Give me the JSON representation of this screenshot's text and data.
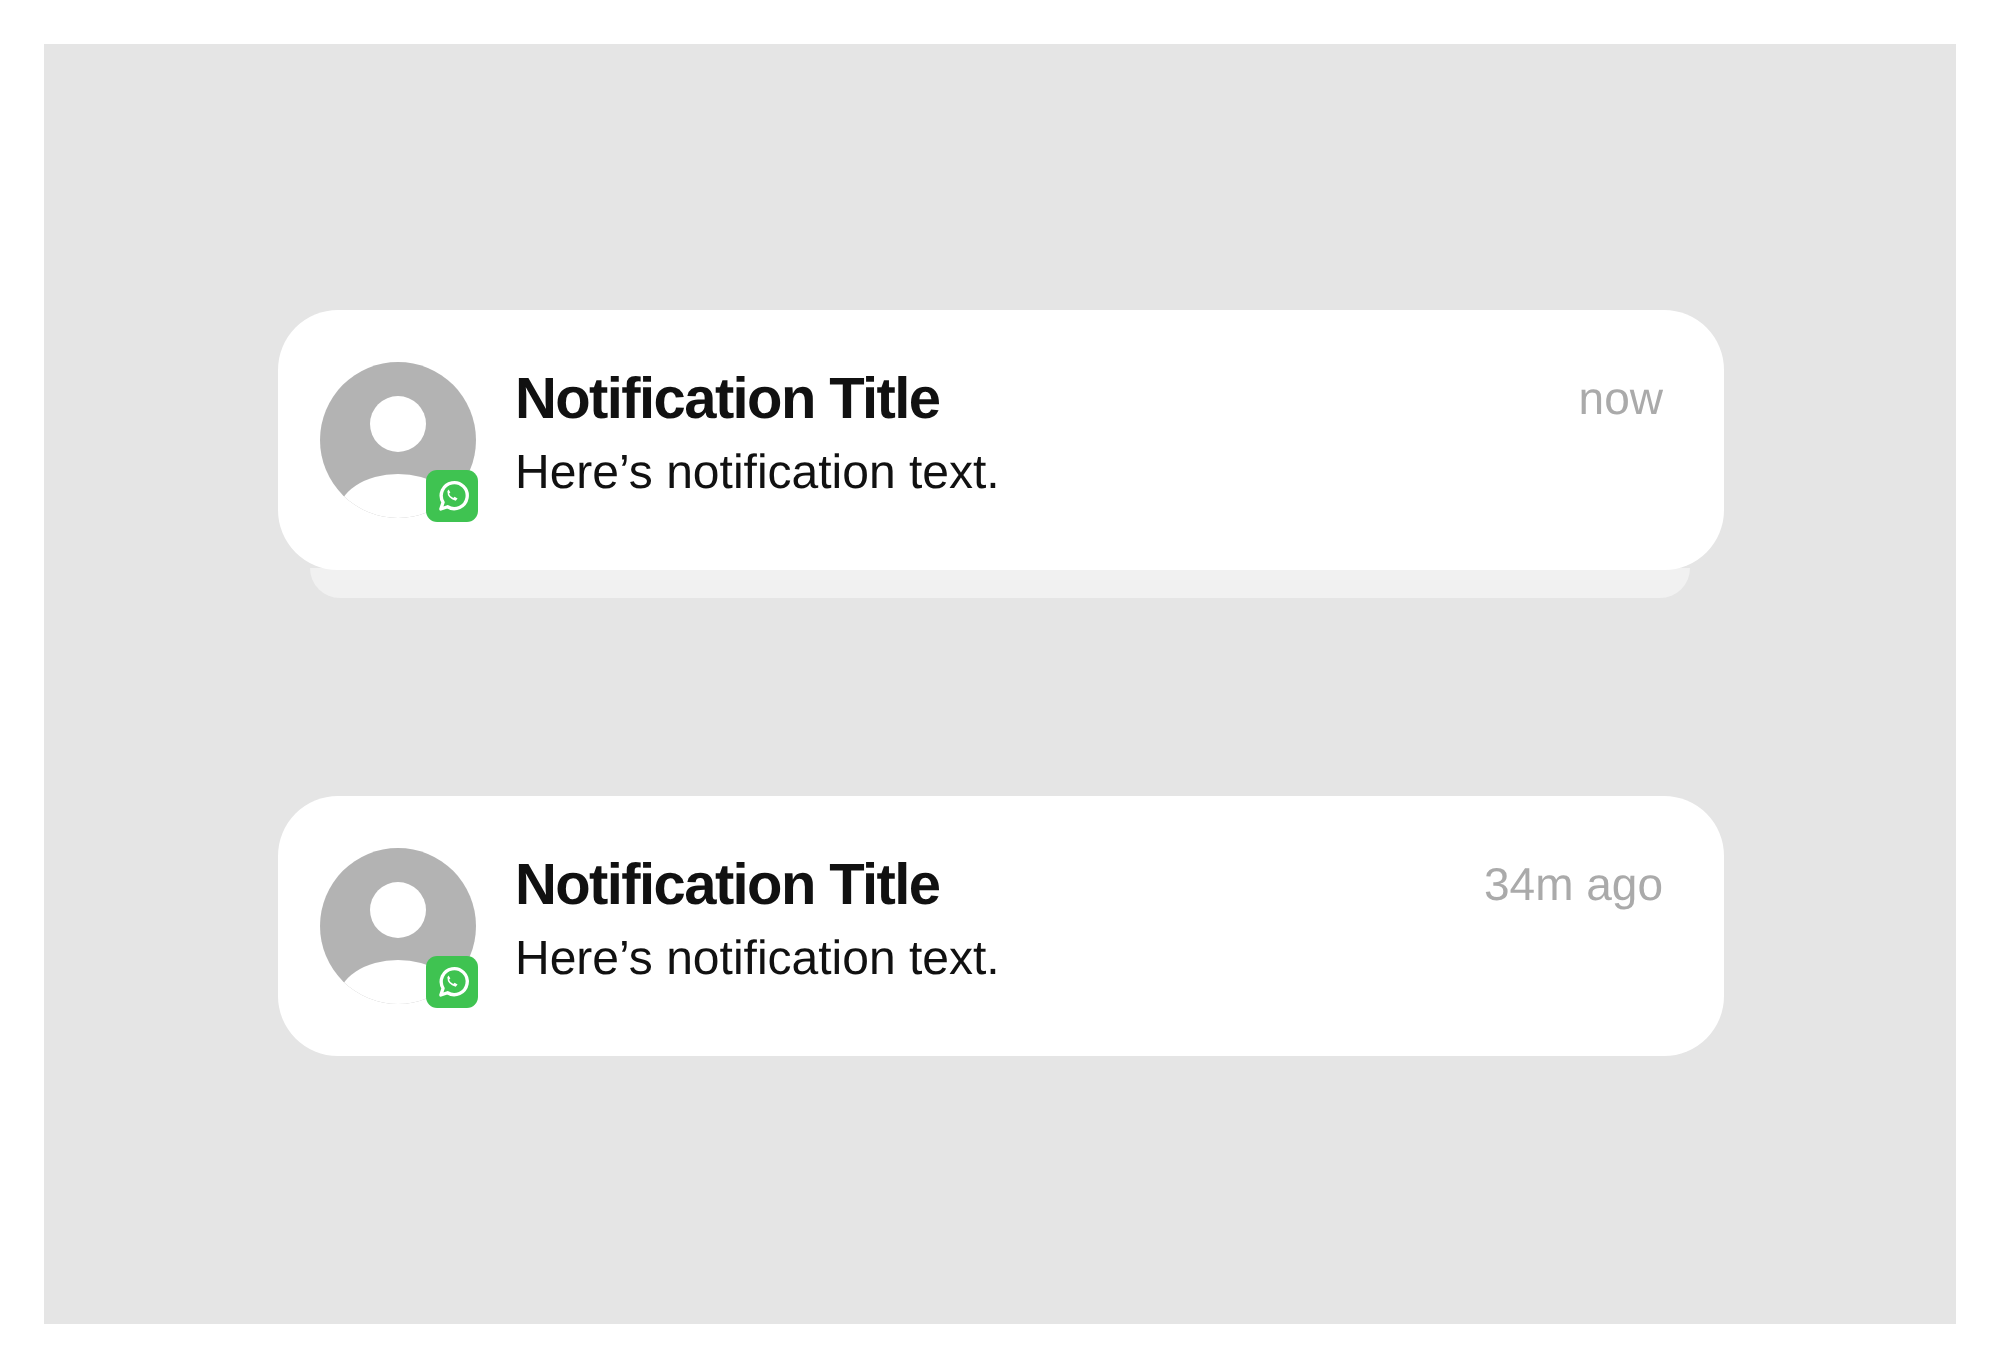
{
  "notifications": [
    {
      "title": "Notification Title",
      "text": "Here’s notification text.",
      "time": "now",
      "stacked": true
    },
    {
      "title": "Notification Title",
      "text": "Here’s notification text.",
      "time": "34m ago",
      "stacked": false
    }
  ]
}
